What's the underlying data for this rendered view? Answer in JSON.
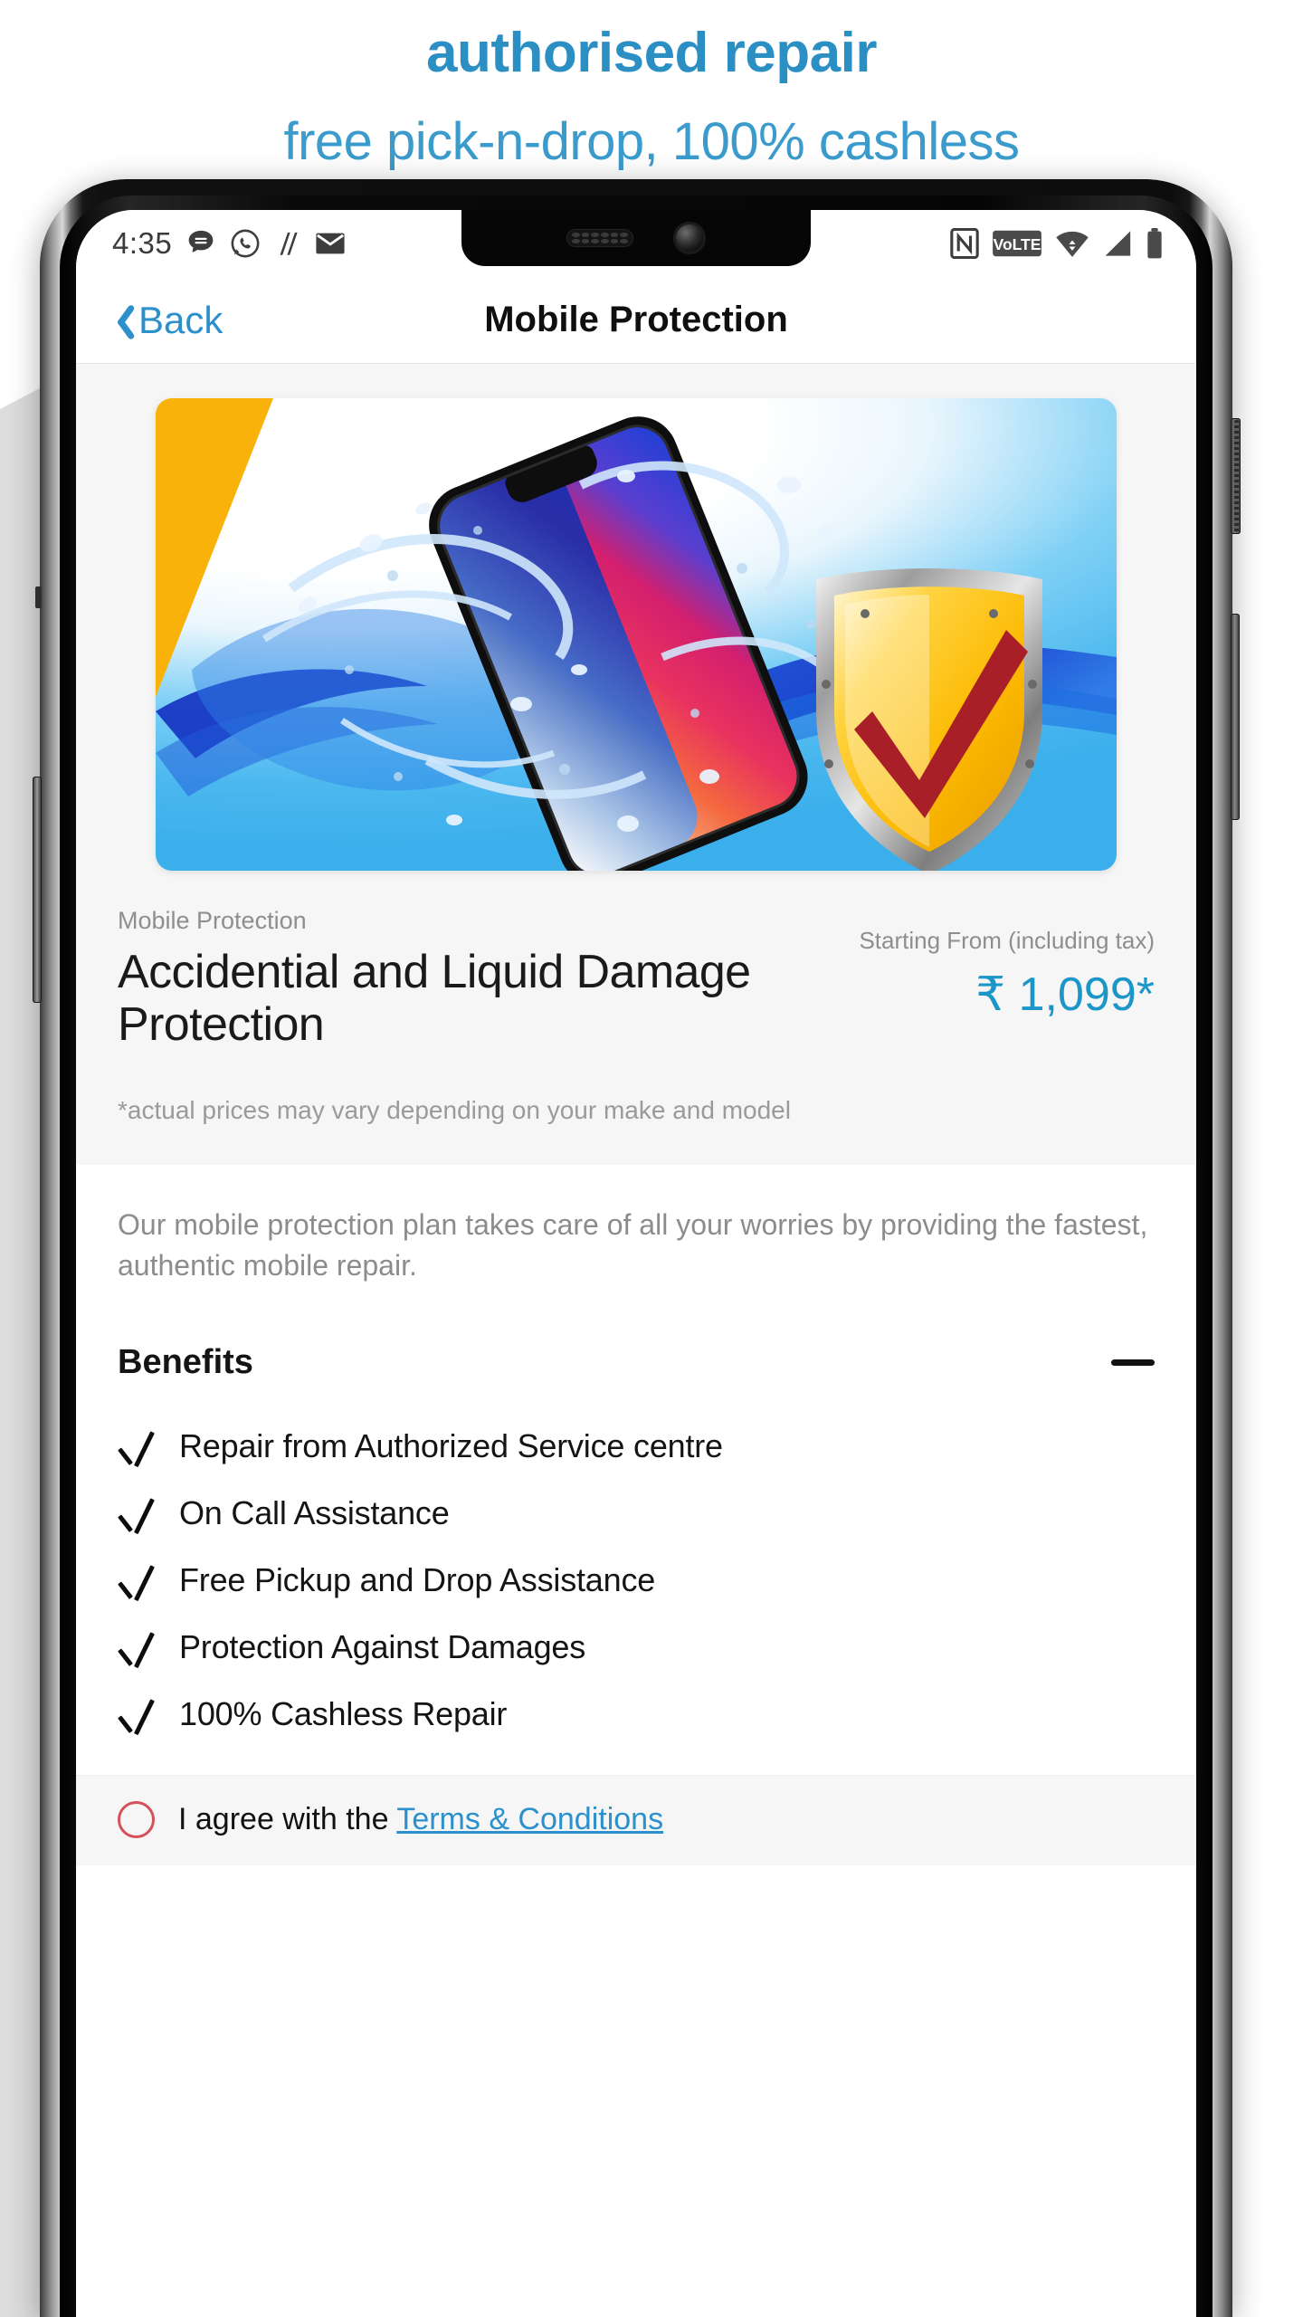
{
  "promo": {
    "line1": "authorised repair",
    "line2": "free pick-n-drop, 100% cashless",
    "color": "#2b8fc4"
  },
  "status_bar": {
    "time": "4:35",
    "left_icons": [
      "messages-icon",
      "whatsapp-icon",
      "nova-launcher-icon",
      "email-icon"
    ],
    "right_icons": [
      "nfc-icon",
      "volte-icon",
      "wifi-icon",
      "cellular-signal-icon",
      "battery-icon"
    ],
    "volte_label": "VoLTE"
  },
  "navbar": {
    "back_label": "Back",
    "title": "Mobile Protection"
  },
  "hero": {
    "alt": "smartphone in water splash with golden protection shield and red checkmark",
    "accent_yellow": "#f9b20a",
    "water_blue": "#3aafec"
  },
  "product": {
    "kicker": "Mobile Protection",
    "title": "Accidential and Liquid Damage Protection",
    "price_label": "Starting From (including tax)",
    "price": "₹ 1,099*",
    "price_color": "#1a96c8",
    "disclaimer": "*actual prices may vary depending on your make and model"
  },
  "description": "Our mobile protection plan takes care of all your worries by providing the fastest, authentic mobile repair.",
  "benefits": {
    "title": "Benefits",
    "toggle_icon": "minus-icon",
    "items": [
      "Repair from Authorized Service centre",
      "On Call Assistance",
      "Free Pickup and Drop Assistance",
      "Protection Against Damages",
      "100% Cashless Repair"
    ]
  },
  "terms": {
    "checkbox_state": "unchecked",
    "checkbox_color": "#d6505c",
    "text": "I agree with the ",
    "link": "Terms & Conditions"
  }
}
